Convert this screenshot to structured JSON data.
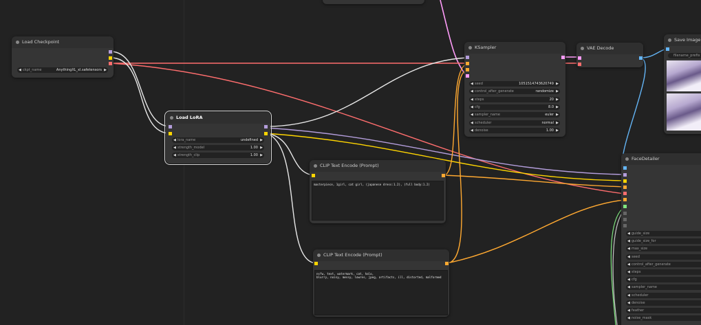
{
  "colors": {
    "background": "#222222",
    "node_body": "#353535",
    "widget_bg": "#222222",
    "wire_model": "#b39ddb",
    "wire_clip": "#ffd500",
    "wire_vae": "#ff6e6e",
    "wire_latent": "#ff9cf9",
    "wire_conditioning": "#ffa931",
    "wire_image": "#64b5f6",
    "wire_white": "#e8e8e8",
    "wire_green": "#7fe57f"
  },
  "nodes": {
    "load_checkpoint": {
      "title": "Load Checkpoint",
      "widgets": [
        {
          "label": "ckpt_name",
          "value": "AnythingXL_xl.safetensors"
        }
      ]
    },
    "load_lora": {
      "title": "Load LoRA",
      "widgets": [
        {
          "label": "lora_name",
          "value": "undefined"
        },
        {
          "label": "strength_model",
          "value": "1.00"
        },
        {
          "label": "strength_clip",
          "value": "1.00"
        }
      ]
    },
    "clip_pos": {
      "title": "CLIP Text Encode (Prompt)",
      "text": "masterpiece, 1girl, cat girl, (japanese dress:1.2), (full body:1.2)"
    },
    "clip_neg": {
      "title": "CLIP Text Encode (Prompt)",
      "text": "nsfw, text, watermark, cat, halo,\nblurry, noisy, messy, lowres, jpeg, artifacts, ill, distorted, malformed"
    },
    "ksampler": {
      "title": "KSampler",
      "widgets": [
        {
          "label": "seed",
          "value": "1051514743620749"
        },
        {
          "label": "control_after_generate",
          "value": "randomize"
        },
        {
          "label": "steps",
          "value": "20"
        },
        {
          "label": "cfg",
          "value": "8.0"
        },
        {
          "label": "sampler_name",
          "value": "euler"
        },
        {
          "label": "scheduler",
          "value": "normal"
        },
        {
          "label": "denoise",
          "value": "1.00"
        }
      ]
    },
    "vae_decode": {
      "title": "VAE Decode"
    },
    "save_image": {
      "title": "Save Image",
      "widget_label": "filename_prefix"
    },
    "face_detailer": {
      "title": "FaceDetailer",
      "widgets": [
        "guide_size",
        "guide_size_for",
        "max_size",
        "seed",
        "control_after_generate",
        "steps",
        "cfg",
        "sampler_name",
        "scheduler",
        "denoise",
        "feather",
        "noise_mask"
      ]
    }
  }
}
